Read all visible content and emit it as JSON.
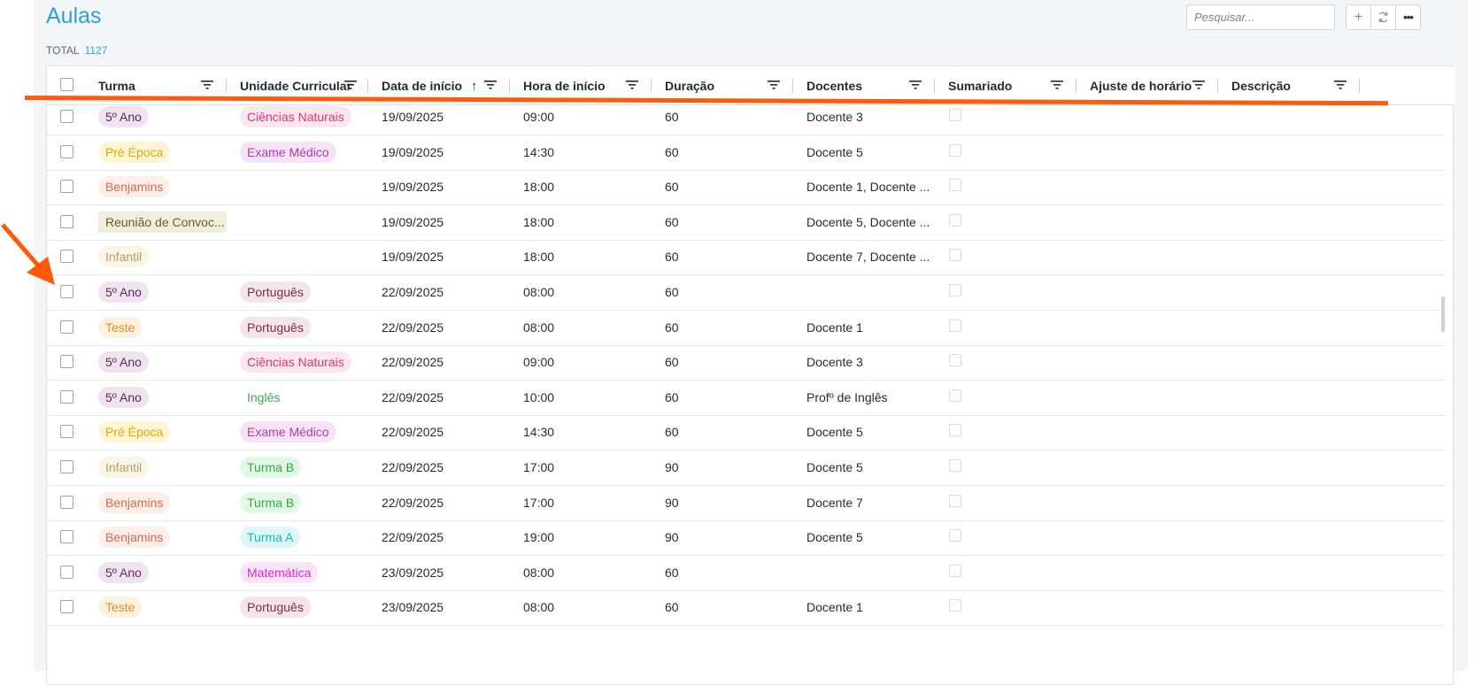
{
  "header": {
    "title": "Aulas",
    "total_label": "TOTAL",
    "total_count": "1127",
    "search_placeholder": "Pesquisar...",
    "add_icon": "plus-icon",
    "refresh_icon": "refresh-icon",
    "more_icon": "more-icon"
  },
  "columns": [
    {
      "key": "turma",
      "label": "Turma"
    },
    {
      "key": "uc",
      "label": "Unidade Curricular"
    },
    {
      "key": "data",
      "label": "Data de início",
      "sort": "asc"
    },
    {
      "key": "hora",
      "label": "Hora de início"
    },
    {
      "key": "duracao",
      "label": "Duração"
    },
    {
      "key": "docentes",
      "label": "Docentes"
    },
    {
      "key": "sumariado",
      "label": "Sumariado"
    },
    {
      "key": "ajuste",
      "label": "Ajuste de horário"
    },
    {
      "key": "descricao",
      "label": "Descrição"
    }
  ],
  "colors": {
    "accent": "#2b9fd8",
    "annotation": "#ff5a0a"
  },
  "rows": [
    {
      "turma": "5º Ano",
      "turma_color": "purple",
      "uc": "Ciências Naturais",
      "uc_color": "pink",
      "data": "19/09/2025",
      "hora": "09:00",
      "duracao": "60",
      "docentes": "Docente 3"
    },
    {
      "turma": "Pré Época",
      "turma_color": "yellow",
      "uc": "Exame Médico",
      "uc_color": "violet",
      "data": "19/09/2025",
      "hora": "14:30",
      "duracao": "60",
      "docentes": "Docente 5"
    },
    {
      "turma": "Benjamins",
      "turma_color": "salmon",
      "uc": "",
      "uc_color": "",
      "data": "19/09/2025",
      "hora": "18:00",
      "duracao": "60",
      "docentes": "Docente 1, Docente ..."
    },
    {
      "turma": "Reunião de Convoc...",
      "turma_color": "khaki",
      "uc": "",
      "uc_color": "",
      "data": "19/09/2025",
      "hora": "18:00",
      "duracao": "60",
      "docentes": "Docente 5, Docente ..."
    },
    {
      "turma": "Infantil",
      "turma_color": "beige",
      "uc": "",
      "uc_color": "",
      "data": "19/09/2025",
      "hora": "18:00",
      "duracao": "60",
      "docentes": "Docente 7, Docente ..."
    },
    {
      "turma": "5º Ano",
      "turma_color": "purple",
      "uc": "Português",
      "uc_color": "rose",
      "data": "22/09/2025",
      "hora": "08:00",
      "duracao": "60",
      "docentes": ""
    },
    {
      "turma": "Teste",
      "turma_color": "orange",
      "uc": "Português",
      "uc_color": "rose",
      "data": "22/09/2025",
      "hora": "08:00",
      "duracao": "60",
      "docentes": "Docente 1"
    },
    {
      "turma": "5º Ano",
      "turma_color": "purple",
      "uc": "Ciências Naturais",
      "uc_color": "pink",
      "data": "22/09/2025",
      "hora": "09:00",
      "duracao": "60",
      "docentes": "Docente 3"
    },
    {
      "turma": "5º Ano",
      "turma_color": "purple",
      "uc": "Inglês",
      "uc_color": "plaingreen",
      "data": "22/09/2025",
      "hora": "10:00",
      "duracao": "60",
      "docentes": "Profº de Inglês"
    },
    {
      "turma": "Pré Época",
      "turma_color": "yellow",
      "uc": "Exame Médico",
      "uc_color": "violet",
      "data": "22/09/2025",
      "hora": "14:30",
      "duracao": "60",
      "docentes": "Docente 5"
    },
    {
      "turma": "Infantil",
      "turma_color": "beige",
      "uc": "Turma B",
      "uc_color": "green",
      "data": "22/09/2025",
      "hora": "17:00",
      "duracao": "90",
      "docentes": "Docente 5"
    },
    {
      "turma": "Benjamins",
      "turma_color": "salmon",
      "uc": "Turma B",
      "uc_color": "green",
      "data": "22/09/2025",
      "hora": "17:00",
      "duracao": "90",
      "docentes": "Docente 7"
    },
    {
      "turma": "Benjamins",
      "turma_color": "salmon",
      "uc": "Turma A",
      "uc_color": "cyan",
      "data": "22/09/2025",
      "hora": "19:00",
      "duracao": "90",
      "docentes": "Docente 5"
    },
    {
      "turma": "5º Ano",
      "turma_color": "purple",
      "uc": "Matemática",
      "uc_color": "magenta",
      "data": "23/09/2025",
      "hora": "08:00",
      "duracao": "60",
      "docentes": ""
    },
    {
      "turma": "Teste",
      "turma_color": "orange",
      "uc": "Português",
      "uc_color": "rose",
      "data": "23/09/2025",
      "hora": "08:00",
      "duracao": "60",
      "docentes": "Docente 1"
    }
  ]
}
